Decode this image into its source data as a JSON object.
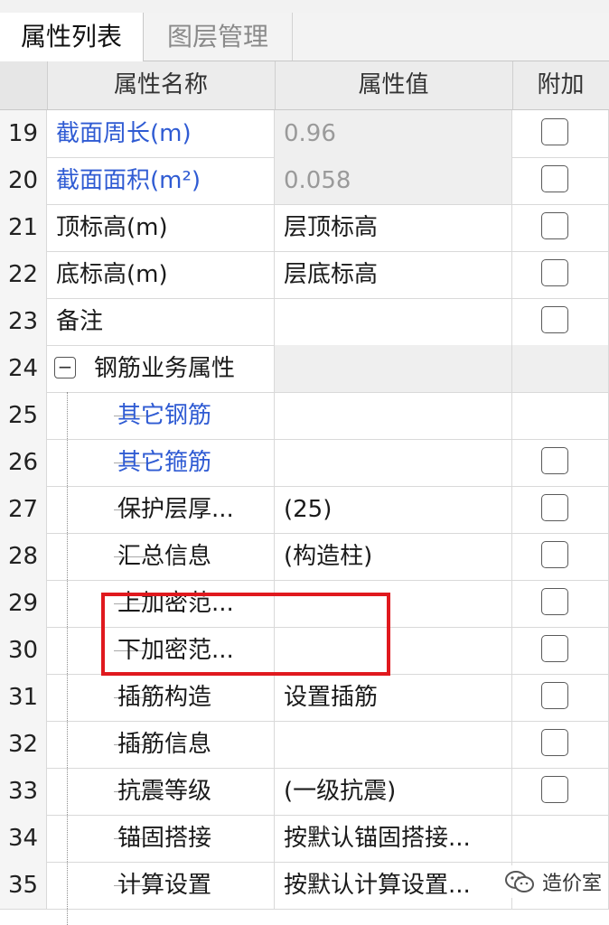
{
  "tabs": [
    {
      "label": "属性列表",
      "active": true
    },
    {
      "label": "图层管理",
      "active": false
    }
  ],
  "columns": {
    "name": "属性名称",
    "value": "属性值",
    "extra": "附加"
  },
  "rows": [
    {
      "num": "19",
      "name": "截面周长(m)",
      "value": "0.96",
      "checkbox": true
    },
    {
      "num": "20",
      "name": "截面面积(m²)",
      "value": "0.058",
      "checkbox": true
    },
    {
      "num": "21",
      "name": "顶标高(m)",
      "value": "层顶标高",
      "checkbox": true
    },
    {
      "num": "22",
      "name": "底标高(m)",
      "value": "层底标高",
      "checkbox": true
    },
    {
      "num": "23",
      "name": "备注",
      "value": "",
      "checkbox": true
    },
    {
      "num": "24",
      "name": "钢筋业务属性",
      "value": "",
      "checkbox": false
    },
    {
      "num": "25",
      "name": "其它钢筋",
      "value": "",
      "checkbox": false
    },
    {
      "num": "26",
      "name": "其它箍筋",
      "value": "",
      "checkbox": true
    },
    {
      "num": "27",
      "name": "保护层厚...",
      "value": "(25)",
      "checkbox": true
    },
    {
      "num": "28",
      "name": "汇总信息",
      "value": "(构造柱)",
      "checkbox": true
    },
    {
      "num": "29",
      "name": "上加密范...",
      "value": "",
      "checkbox": true
    },
    {
      "num": "30",
      "name": "下加密范...",
      "value": "",
      "checkbox": true
    },
    {
      "num": "31",
      "name": "插筋构造",
      "value": "设置插筋",
      "checkbox": true
    },
    {
      "num": "32",
      "name": "插筋信息",
      "value": "",
      "checkbox": true
    },
    {
      "num": "33",
      "name": "抗震等级",
      "value": "(一级抗震)",
      "checkbox": true
    },
    {
      "num": "34",
      "name": "锚固搭接",
      "value": "按默认锚固搭接...",
      "checkbox": false
    },
    {
      "num": "35",
      "name": "计算设置",
      "value": "按默认计算设置...",
      "checkbox": false
    }
  ],
  "collapse_symbol": "−",
  "watermark": {
    "text": "造价室"
  },
  "colors": {
    "link_blue": "#2f5bd3",
    "highlight_red": "#e0191e",
    "readonly_grey": "#efefef"
  }
}
